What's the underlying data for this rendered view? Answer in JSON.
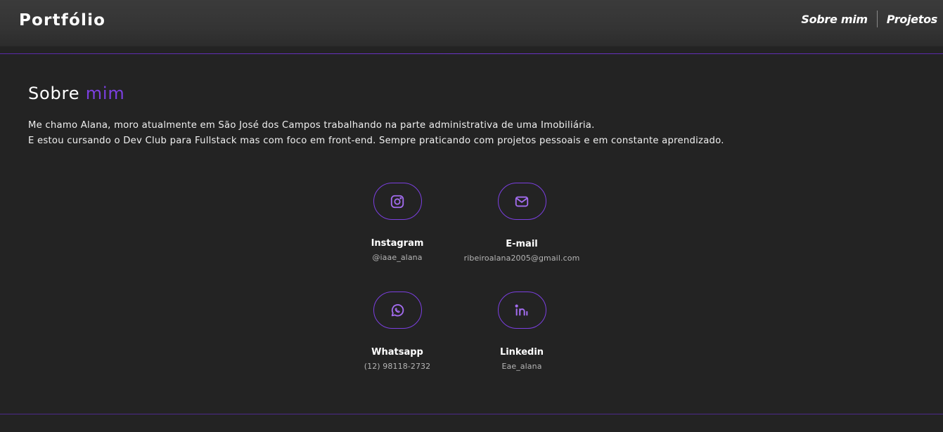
{
  "header": {
    "logo": "Portfólio",
    "nav": [
      {
        "label": "Sobre mim"
      },
      {
        "label": "Projetos"
      }
    ]
  },
  "about": {
    "title_main": "Sobre ",
    "title_accent": "mim",
    "paragraph_1": "Me chamo Alana, moro atualmente em São José dos Campos trabalhando na parte administrativa de uma Imobiliária.",
    "paragraph_2": "E estou cursando o Dev Club para Fullstack mas com foco em front-end. Sempre praticando com projetos pessoais e em constante aprendizado."
  },
  "contacts": [
    {
      "name": "Instagram",
      "value": "@iaae_alana",
      "icon": "instagram-icon"
    },
    {
      "name": "E-mail",
      "value": "ribeiroalana2005@gmail.com",
      "icon": "mail-icon"
    },
    {
      "name": "Whatsapp",
      "value": "(12) 98118-2732",
      "icon": "whatsapp-icon"
    },
    {
      "name": "Linkedin",
      "value": "Eae_alana",
      "icon": "linkedin-icon"
    }
  ],
  "colors": {
    "accent": "#7b3fe0",
    "background": "#232323",
    "header": "#363636"
  }
}
